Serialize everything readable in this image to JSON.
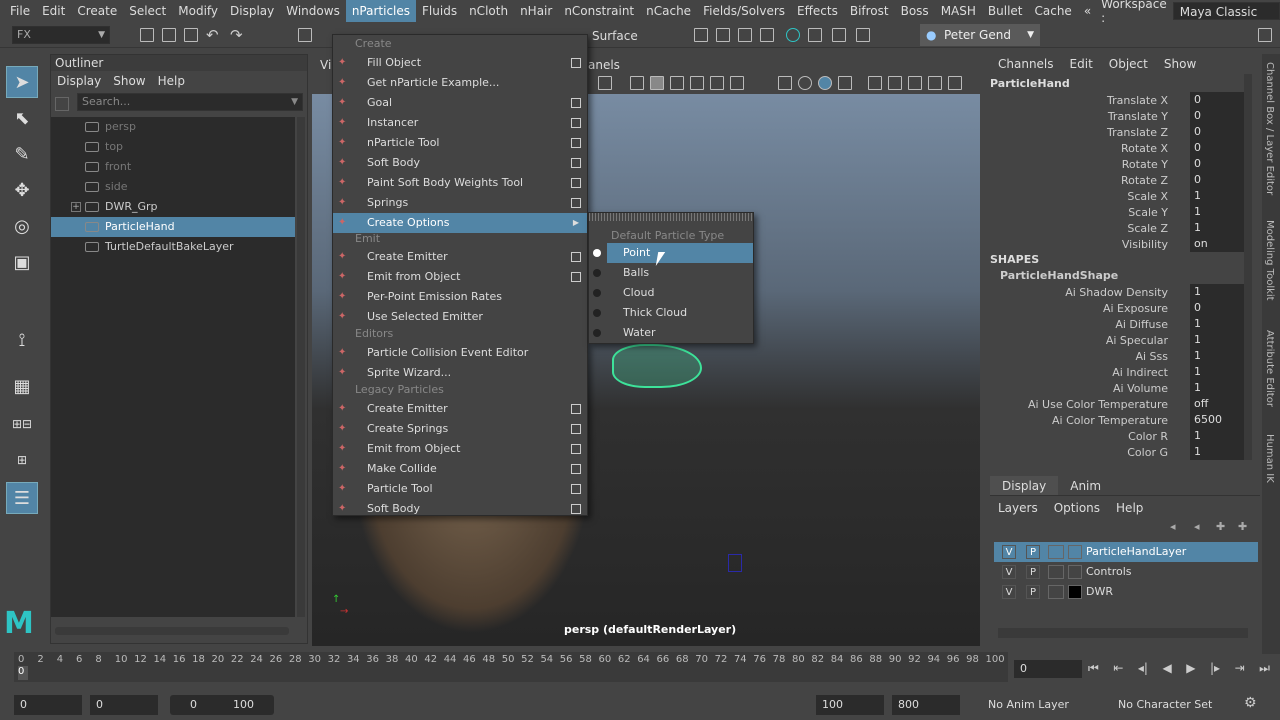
{
  "menubar": {
    "items": [
      "File",
      "Edit",
      "Create",
      "Select",
      "Modify",
      "Display",
      "Windows",
      "nParticles",
      "Fluids",
      "nCloth",
      "nHair",
      "nConstraint",
      "nCache",
      "Fields/Solvers",
      "Effects",
      "Bifrost",
      "Boss",
      "MASH",
      "Bullet",
      "Cache"
    ],
    "active_index": 7,
    "overflow": "«",
    "workspace_label": "Workspace :",
    "workspace_value": "Maya Classic"
  },
  "statusline": {
    "menuset": "FX",
    "surface_label": "Surface",
    "user": "Peter Gend"
  },
  "outliner": {
    "title": "Outliner",
    "menu": [
      "Display",
      "Show",
      "Help"
    ],
    "search_placeholder": "Search...",
    "rows": [
      {
        "label": "persp",
        "dim": true
      },
      {
        "label": "top",
        "dim": true
      },
      {
        "label": "front",
        "dim": true
      },
      {
        "label": "side",
        "dim": true
      },
      {
        "label": "DWR_Grp",
        "dim": false,
        "expand": "+"
      },
      {
        "label": "ParticleHand",
        "dim": false,
        "selected": true
      },
      {
        "label": "TurtleDefaultBakeLayer",
        "dim": false
      }
    ]
  },
  "viewport": {
    "panel_label": "Vi",
    "channels_label": "anels",
    "camera_label": "persp (defaultRenderLayer)"
  },
  "npmenu": {
    "sections": {
      "create": "Create",
      "emit": "Emit",
      "editors": "Editors",
      "legacy": "Legacy Particles"
    },
    "create_items": [
      {
        "label": "Fill Object",
        "opt": true
      },
      {
        "label": "Get nParticle Example...",
        "opt": false
      },
      {
        "label": "Goal",
        "opt": true
      },
      {
        "label": "Instancer",
        "opt": true
      },
      {
        "label": "nParticle Tool",
        "opt": true
      },
      {
        "label": "Soft Body",
        "opt": true
      },
      {
        "label": "Paint Soft Body Weights Tool",
        "opt": true
      },
      {
        "label": "Springs",
        "opt": true
      },
      {
        "label": "Create Options",
        "opt": false,
        "submenu": true,
        "highlight": true
      }
    ],
    "emit_items": [
      {
        "label": "Create Emitter",
        "opt": true
      },
      {
        "label": "Emit from Object",
        "opt": true
      },
      {
        "label": "Per-Point Emission Rates",
        "opt": false
      },
      {
        "label": "Use Selected Emitter",
        "opt": false
      }
    ],
    "editors_items": [
      {
        "label": "Particle Collision Event Editor",
        "opt": false
      },
      {
        "label": "Sprite Wizard...",
        "opt": false
      }
    ],
    "legacy_items": [
      {
        "label": "Create Emitter",
        "opt": true
      },
      {
        "label": "Create Springs",
        "opt": true
      },
      {
        "label": "Emit from Object",
        "opt": true
      },
      {
        "label": "Make Collide",
        "opt": true
      },
      {
        "label": "Particle Tool",
        "opt": true
      },
      {
        "label": "Soft Body",
        "opt": true
      }
    ]
  },
  "submenu": {
    "title": "Default Particle Type",
    "items": [
      {
        "label": "Point",
        "selected": true,
        "highlight": true
      },
      {
        "label": "Balls",
        "selected": false
      },
      {
        "label": "Cloud",
        "selected": false
      },
      {
        "label": "Thick Cloud",
        "selected": false
      },
      {
        "label": "Water",
        "selected": false
      }
    ]
  },
  "channelbox": {
    "menu": [
      "Channels",
      "Edit",
      "Object",
      "Show"
    ],
    "object": "ParticleHand",
    "transform_attrs": [
      {
        "name": "Translate X",
        "value": "0"
      },
      {
        "name": "Translate Y",
        "value": "0"
      },
      {
        "name": "Translate Z",
        "value": "0"
      },
      {
        "name": "Rotate X",
        "value": "0"
      },
      {
        "name": "Rotate Y",
        "value": "0"
      },
      {
        "name": "Rotate Z",
        "value": "0"
      },
      {
        "name": "Scale X",
        "value": "1"
      },
      {
        "name": "Scale Y",
        "value": "1"
      },
      {
        "name": "Scale Z",
        "value": "1"
      },
      {
        "name": "Visibility",
        "value": "on"
      }
    ],
    "shapes_label": "SHAPES",
    "shape_name": "ParticleHandShape",
    "shape_attrs": [
      {
        "name": "Ai Shadow Density",
        "value": "1"
      },
      {
        "name": "Ai Exposure",
        "value": "0"
      },
      {
        "name": "Ai Diffuse",
        "value": "1"
      },
      {
        "name": "Ai Specular",
        "value": "1"
      },
      {
        "name": "Ai Sss",
        "value": "1"
      },
      {
        "name": "Ai Indirect",
        "value": "1"
      },
      {
        "name": "Ai Volume",
        "value": "1"
      },
      {
        "name": "Ai Use Color Temperature",
        "value": "off"
      },
      {
        "name": "Ai Color Temperature",
        "value": "6500"
      },
      {
        "name": "Color R",
        "value": "1"
      },
      {
        "name": "Color G",
        "value": "1"
      }
    ]
  },
  "sidetabs": [
    "Channel Box / Layer Editor",
    "Modeling Toolkit",
    "Attribute Editor",
    "Human IK"
  ],
  "layers": {
    "tabs": [
      "Display",
      "Anim"
    ],
    "menu": [
      "Layers",
      "Options",
      "Help"
    ],
    "items": [
      {
        "v": "V",
        "p": "P",
        "name": "ParticleHandLayer",
        "selected": true
      },
      {
        "v": "V",
        "p": "P",
        "name": "Controls",
        "selected": false
      },
      {
        "v": "V",
        "p": "P",
        "name": "DWR",
        "selected": false
      }
    ]
  },
  "timeline": {
    "ticks": [
      "0",
      "2",
      "4",
      "6",
      "8",
      "10",
      "12",
      "14",
      "16",
      "18",
      "20",
      "22",
      "24",
      "26",
      "28",
      "30",
      "32",
      "34",
      "36",
      "38",
      "40",
      "42",
      "44",
      "46",
      "48",
      "50",
      "52",
      "54",
      "56",
      "58",
      "60",
      "62",
      "64",
      "66",
      "68",
      "70",
      "72",
      "74",
      "76",
      "78",
      "80",
      "82",
      "84",
      "86",
      "88",
      "90",
      "92",
      "94",
      "96",
      "98",
      "100"
    ],
    "current_frame": "0",
    "frame_field": "0"
  },
  "range": {
    "start": "0",
    "playback_start": "0",
    "slider_in": "0",
    "slider_out": "100",
    "playback_end": "100",
    "end": "800",
    "anim_layer": "No Anim Layer",
    "char_set": "No Character Set"
  }
}
